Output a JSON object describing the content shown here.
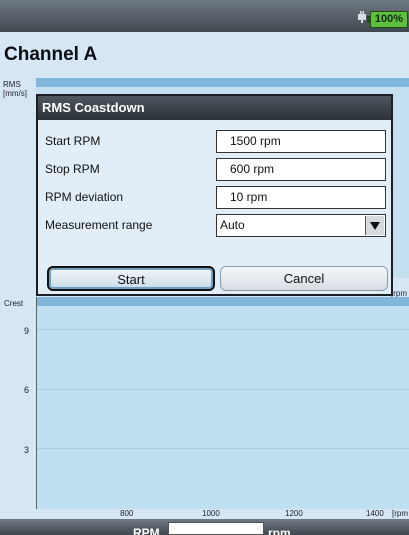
{
  "statusbar": {
    "battery_text": "100%",
    "icons": [
      "plug-icon",
      "battery-icon"
    ]
  },
  "page": {
    "title": "Channel A"
  },
  "upper_chart": {
    "y_label_line1": "RMS",
    "y_label_line2": "[mm/s]",
    "x_unit": "[rpm"
  },
  "lower_chart": {
    "y_label": "Crest",
    "y_ticks": [
      "9",
      "6",
      "3"
    ],
    "x_ticks": [
      "800",
      "1000",
      "1200",
      "1400"
    ],
    "x_unit": "[rpm"
  },
  "dialog": {
    "title": "RMS Coastdown",
    "start_rpm": {
      "label": "Start RPM",
      "value": "1500 rpm"
    },
    "stop_rpm": {
      "label": "Stop RPM",
      "value": "600 rpm"
    },
    "rpm_deviation": {
      "label": "RPM deviation",
      "value": "10 rpm"
    },
    "measurement_range": {
      "label": "Measurement range",
      "value": "Auto"
    },
    "start_label": "Start",
    "cancel_label": "Cancel"
  },
  "bottombar": {
    "rpm_label": "RPM",
    "unit": "rpm"
  },
  "colors": {
    "accent_band": "#7fb6dc",
    "chart_bg": "#bfe0f0",
    "battery": "#5fbf3f"
  }
}
